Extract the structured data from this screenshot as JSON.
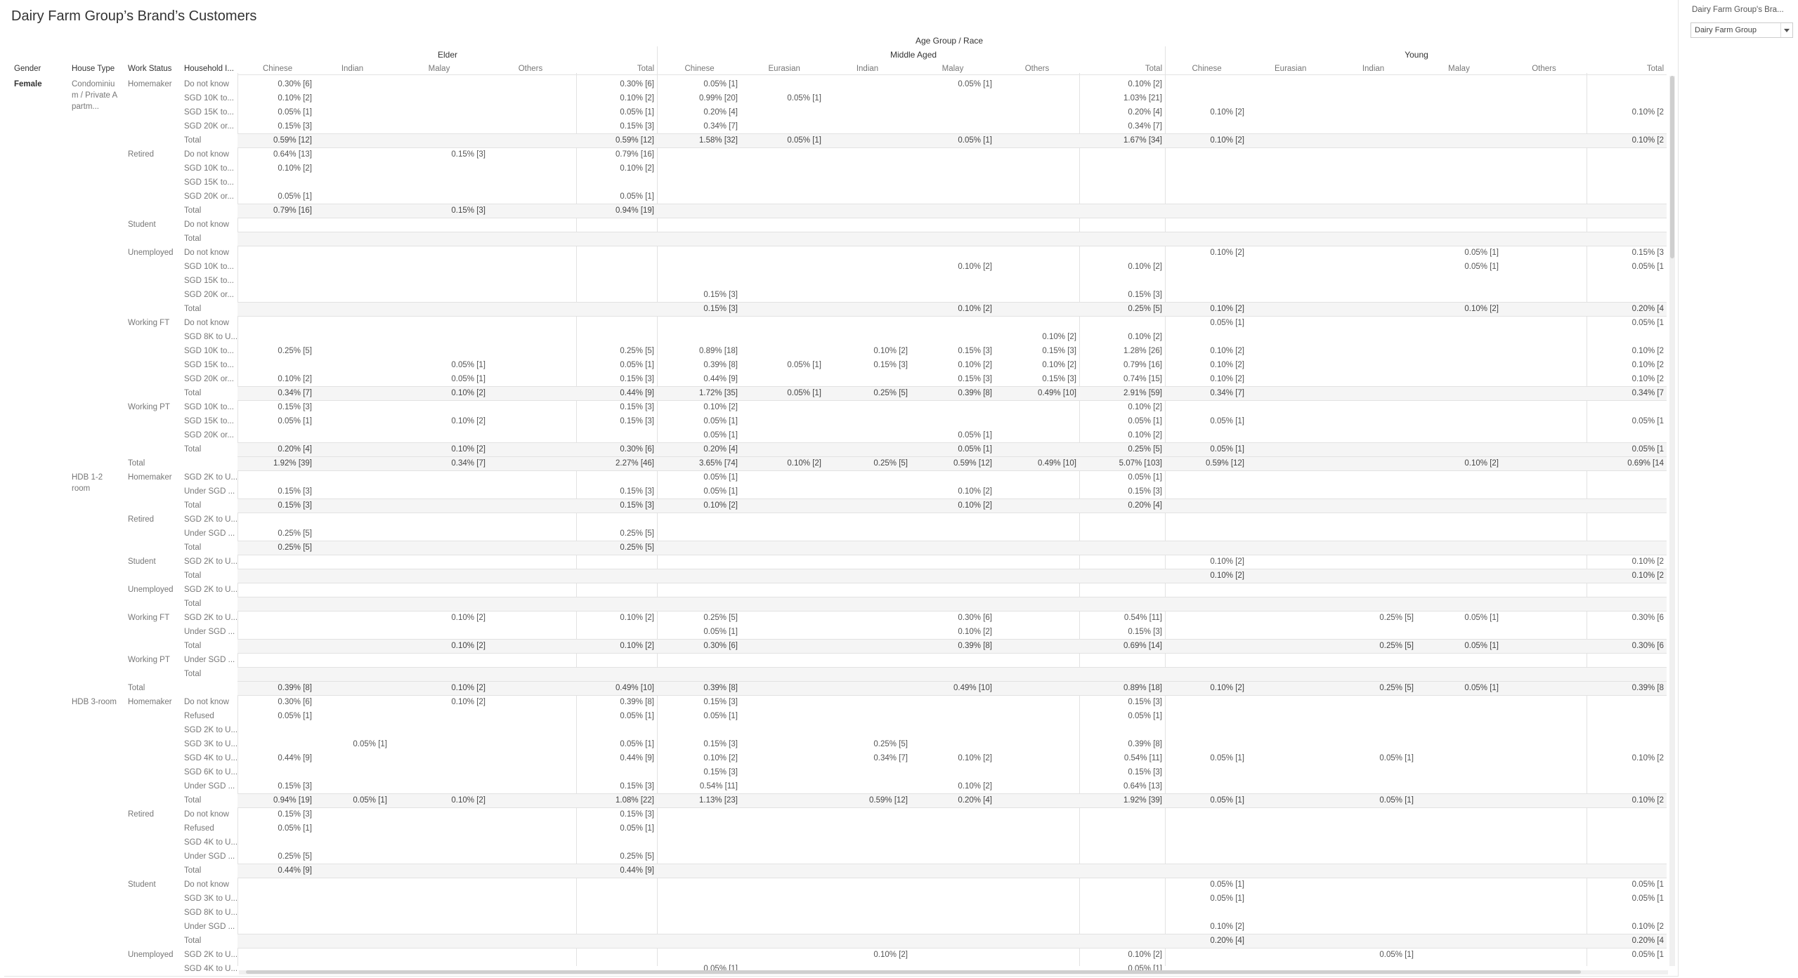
{
  "title": "Dairy Farm Group’s Brand’s Customers",
  "filter": {
    "title": "Dairy Farm Group's Bra...",
    "value": "Dairy Farm Group"
  },
  "header": {
    "top": "Age Group / Race",
    "groups": [
      "Elder",
      "Middle Aged",
      "Young"
    ],
    "row_headers": [
      "Gender",
      "House Type",
      "Work Status",
      "Household I..."
    ],
    "columns": [
      "Chinese",
      "Indian",
      "Malay",
      "Others",
      "Total",
      "Chinese",
      "Eurasian",
      "Indian",
      "Malay",
      "Others",
      "Total",
      "Chinese",
      "Eurasian",
      "Indian",
      "Malay",
      "Others",
      "Total"
    ]
  },
  "groups": [
    {
      "label": "Female",
      "row": 0
    },
    {
      "label": "Condominiu\nm / Private A\npartm...",
      "row": 0
    },
    {
      "label": "HDB 1-2\nroom",
      "row": 28
    },
    {
      "label": "HDB 3-room",
      "row": 44
    }
  ],
  "work_labels": [
    {
      "label": "Homemaker",
      "row": 0
    },
    {
      "label": "Retired",
      "row": 5
    },
    {
      "label": "Student",
      "row": 10
    },
    {
      "label": "Unemployed",
      "row": 12
    },
    {
      "label": "Working FT",
      "row": 17
    },
    {
      "label": "Working PT",
      "row": 23
    },
    {
      "label": "Total",
      "row": 27
    },
    {
      "label": "Homemaker",
      "row": 28
    },
    {
      "label": "Retired",
      "row": 31
    },
    {
      "label": "Student",
      "row": 34
    },
    {
      "label": "Unemployed",
      "row": 36
    },
    {
      "label": "Working FT",
      "row": 38
    },
    {
      "label": "Working PT",
      "row": 41
    },
    {
      "label": "Total",
      "row": 43
    },
    {
      "label": "Homemaker",
      "row": 44
    },
    {
      "label": "Retired",
      "row": 52
    },
    {
      "label": "Student",
      "row": 57
    },
    {
      "label": "Unemployed",
      "row": 62
    }
  ],
  "rows": [
    {
      "label": "Do not know",
      "cells": {
        "0": "0.30% [6]",
        "4": "0.30% [6]",
        "5": "0.05% [1]",
        "8": "0.05% [1]",
        "10": "0.10% [2]"
      }
    },
    {
      "label": "SGD 10K to...",
      "cells": {
        "0": "0.10% [2]",
        "4": "0.10% [2]",
        "5": "0.99% [20]",
        "6": "0.05% [1]",
        "10": "1.03% [21]"
      }
    },
    {
      "label": "SGD 15K to...",
      "cells": {
        "0": "0.05% [1]",
        "4": "0.05% [1]",
        "5": "0.20% [4]",
        "10": "0.20% [4]",
        "11": "0.10% [2]",
        "16": "0.10% [2"
      }
    },
    {
      "label": "SGD 20K or...",
      "cells": {
        "0": "0.15% [3]",
        "4": "0.15% [3]",
        "5": "0.34% [7]",
        "10": "0.34% [7]"
      }
    },
    {
      "label": "Total",
      "total": true,
      "cells": {
        "0": "0.59% [12]",
        "4": "0.59% [12]",
        "5": "1.58% [32]",
        "6": "0.05% [1]",
        "8": "0.05% [1]",
        "10": "1.67% [34]",
        "11": "0.10% [2]",
        "16": "0.10% [2"
      }
    },
    {
      "label": "Do not know",
      "cells": {
        "0": "0.64% [13]",
        "2": "0.15% [3]",
        "4": "0.79% [16]"
      }
    },
    {
      "label": "SGD 10K to...",
      "cells": {
        "0": "0.10% [2]",
        "4": "0.10% [2]"
      }
    },
    {
      "label": "SGD 15K to...",
      "cells": {}
    },
    {
      "label": "SGD 20K or...",
      "cells": {
        "0": "0.05% [1]",
        "4": "0.05% [1]"
      }
    },
    {
      "label": "Total",
      "total": true,
      "cells": {
        "0": "0.79% [16]",
        "2": "0.15% [3]",
        "4": "0.94% [19]"
      }
    },
    {
      "label": "Do not know",
      "cells": {}
    },
    {
      "label": "Total",
      "total": true,
      "cells": {}
    },
    {
      "label": "Do not know",
      "cells": {
        "11": "0.10% [2]",
        "14": "0.05% [1]",
        "16": "0.15% [3"
      }
    },
    {
      "label": "SGD 10K to...",
      "cells": {
        "8": "0.10% [2]",
        "10": "0.10% [2]",
        "14": "0.05% [1]",
        "16": "0.05% [1"
      }
    },
    {
      "label": "SGD 15K to...",
      "cells": {}
    },
    {
      "label": "SGD 20K or...",
      "cells": {
        "5": "0.15% [3]",
        "10": "0.15% [3]"
      }
    },
    {
      "label": "Total",
      "total": true,
      "cells": {
        "5": "0.15% [3]",
        "8": "0.10% [2]",
        "10": "0.25% [5]",
        "11": "0.10% [2]",
        "14": "0.10% [2]",
        "16": "0.20% [4"
      }
    },
    {
      "label": "Do not know",
      "cells": {
        "11": "0.05% [1]",
        "16": "0.05% [1"
      }
    },
    {
      "label": "SGD 8K to U...",
      "cells": {
        "9": "0.10% [2]",
        "10": "0.10% [2]"
      }
    },
    {
      "label": "SGD 10K to...",
      "cells": {
        "0": "0.25% [5]",
        "4": "0.25% [5]",
        "5": "0.89% [18]",
        "7": "0.10% [2]",
        "8": "0.15% [3]",
        "9": "0.15% [3]",
        "10": "1.28% [26]",
        "11": "0.10% [2]",
        "16": "0.10% [2"
      }
    },
    {
      "label": "SGD 15K to...",
      "cells": {
        "2": "0.05% [1]",
        "4": "0.05% [1]",
        "5": "0.39% [8]",
        "6": "0.05% [1]",
        "7": "0.15% [3]",
        "8": "0.10% [2]",
        "9": "0.10% [2]",
        "10": "0.79% [16]",
        "11": "0.10% [2]",
        "16": "0.10% [2"
      }
    },
    {
      "label": "SGD 20K or...",
      "cells": {
        "0": "0.10% [2]",
        "2": "0.05% [1]",
        "4": "0.15% [3]",
        "5": "0.44% [9]",
        "8": "0.15% [3]",
        "9": "0.15% [3]",
        "10": "0.74% [15]",
        "11": "0.10% [2]",
        "16": "0.10% [2"
      }
    },
    {
      "label": "Total",
      "total": true,
      "cells": {
        "0": "0.34% [7]",
        "2": "0.10% [2]",
        "4": "0.44% [9]",
        "5": "1.72% [35]",
        "6": "0.05% [1]",
        "7": "0.25% [5]",
        "8": "0.39% [8]",
        "9": "0.49% [10]",
        "10": "2.91% [59]",
        "11": "0.34% [7]",
        "16": "0.34% [7"
      }
    },
    {
      "label": "SGD 10K to...",
      "cells": {
        "0": "0.15% [3]",
        "4": "0.15% [3]",
        "5": "0.10% [2]",
        "10": "0.10% [2]"
      }
    },
    {
      "label": "SGD 15K to...",
      "cells": {
        "0": "0.05% [1]",
        "2": "0.10% [2]",
        "4": "0.15% [3]",
        "5": "0.05% [1]",
        "10": "0.05% [1]",
        "11": "0.05% [1]",
        "16": "0.05% [1"
      }
    },
    {
      "label": "SGD 20K or...",
      "cells": {
        "5": "0.05% [1]",
        "8": "0.05% [1]",
        "10": "0.10% [2]"
      }
    },
    {
      "label": "Total",
      "total": true,
      "cells": {
        "0": "0.20% [4]",
        "2": "0.10% [2]",
        "4": "0.30% [6]",
        "5": "0.20% [4]",
        "8": "0.05% [1]",
        "10": "0.25% [5]",
        "11": "0.05% [1]",
        "16": "0.05% [1"
      }
    },
    {
      "label": "",
      "grand": true,
      "cells": {
        "0": "1.92% [39]",
        "2": "0.34% [7]",
        "4": "2.27% [46]",
        "5": "3.65% [74]",
        "6": "0.10% [2]",
        "7": "0.25% [5]",
        "8": "0.59% [12]",
        "9": "0.49% [10]",
        "10": "5.07% [103]",
        "11": "0.59% [12]",
        "14": "0.10% [2]",
        "16": "0.69% [14"
      }
    },
    {
      "label": "SGD 2K to U...",
      "cells": {
        "5": "0.05% [1]",
        "10": "0.05% [1]"
      }
    },
    {
      "label": "Under SGD ...",
      "cells": {
        "0": "0.15% [3]",
        "4": "0.15% [3]",
        "5": "0.05% [1]",
        "8": "0.10% [2]",
        "10": "0.15% [3]"
      }
    },
    {
      "label": "Total",
      "total": true,
      "cells": {
        "0": "0.15% [3]",
        "4": "0.15% [3]",
        "5": "0.10% [2]",
        "8": "0.10% [2]",
        "10": "0.20% [4]"
      }
    },
    {
      "label": "SGD 2K to U...",
      "cells": {}
    },
    {
      "label": "Under SGD ...",
      "cells": {
        "0": "0.25% [5]",
        "4": "0.25% [5]"
      }
    },
    {
      "label": "Total",
      "total": true,
      "cells": {
        "0": "0.25% [5]",
        "4": "0.25% [5]"
      }
    },
    {
      "label": "SGD 2K to U...",
      "cells": {
        "11": "0.10% [2]",
        "16": "0.10% [2"
      }
    },
    {
      "label": "Total",
      "total": true,
      "cells": {
        "11": "0.10% [2]",
        "16": "0.10% [2"
      }
    },
    {
      "label": "SGD 2K to U...",
      "cells": {}
    },
    {
      "label": "Total",
      "total": true,
      "cells": {}
    },
    {
      "label": "SGD 2K to U...",
      "cells": {
        "2": "0.10% [2]",
        "4": "0.10% [2]",
        "5": "0.25% [5]",
        "8": "0.30% [6]",
        "10": "0.54% [11]",
        "13": "0.25% [5]",
        "14": "0.05% [1]",
        "16": "0.30% [6"
      }
    },
    {
      "label": "Under SGD ...",
      "cells": {
        "5": "0.05% [1]",
        "8": "0.10% [2]",
        "10": "0.15% [3]"
      }
    },
    {
      "label": "Total",
      "total": true,
      "cells": {
        "2": "0.10% [2]",
        "4": "0.10% [2]",
        "5": "0.30% [6]",
        "8": "0.39% [8]",
        "10": "0.69% [14]",
        "13": "0.25% [5]",
        "14": "0.05% [1]",
        "16": "0.30% [6"
      }
    },
    {
      "label": "Under SGD ...",
      "cells": {}
    },
    {
      "label": "Total",
      "total": true,
      "cells": {}
    },
    {
      "label": "",
      "grand": true,
      "cells": {
        "0": "0.39% [8]",
        "2": "0.10% [2]",
        "4": "0.49% [10]",
        "5": "0.39% [8]",
        "8": "0.49% [10]",
        "10": "0.89% [18]",
        "11": "0.10% [2]",
        "13": "0.25% [5]",
        "14": "0.05% [1]",
        "16": "0.39% [8"
      }
    },
    {
      "label": "Do not know",
      "cells": {
        "0": "0.30% [6]",
        "2": "0.10% [2]",
        "4": "0.39% [8]",
        "5": "0.15% [3]",
        "10": "0.15% [3]"
      }
    },
    {
      "label": "Refused",
      "cells": {
        "0": "0.05% [1]",
        "4": "0.05% [1]",
        "5": "0.05% [1]",
        "10": "0.05% [1]"
      }
    },
    {
      "label": "SGD 2K to U...",
      "cells": {}
    },
    {
      "label": "SGD 3K to U...",
      "cells": {
        "1": "0.05% [1]",
        "4": "0.05% [1]",
        "5": "0.15% [3]",
        "7": "0.25% [5]",
        "10": "0.39% [8]"
      }
    },
    {
      "label": "SGD 4K to U...",
      "cells": {
        "0": "0.44% [9]",
        "4": "0.44% [9]",
        "5": "0.10% [2]",
        "7": "0.34% [7]",
        "8": "0.10% [2]",
        "10": "0.54% [11]",
        "11": "0.05% [1]",
        "13": "0.05% [1]",
        "16": "0.10% [2"
      }
    },
    {
      "label": "SGD 6K to U...",
      "cells": {
        "5": "0.15% [3]",
        "10": "0.15% [3]"
      }
    },
    {
      "label": "Under SGD ...",
      "cells": {
        "0": "0.15% [3]",
        "4": "0.15% [3]",
        "5": "0.54% [11]",
        "8": "0.10% [2]",
        "10": "0.64% [13]"
      }
    },
    {
      "label": "Total",
      "total": true,
      "cells": {
        "0": "0.94% [19]",
        "1": "0.05% [1]",
        "2": "0.10% [2]",
        "4": "1.08% [22]",
        "5": "1.13% [23]",
        "7": "0.59% [12]",
        "8": "0.20% [4]",
        "10": "1.92% [39]",
        "11": "0.05% [1]",
        "13": "0.05% [1]",
        "16": "0.10% [2"
      }
    },
    {
      "label": "Do not know",
      "cells": {
        "0": "0.15% [3]",
        "4": "0.15% [3]"
      }
    },
    {
      "label": "Refused",
      "cells": {
        "0": "0.05% [1]",
        "4": "0.05% [1]"
      }
    },
    {
      "label": "SGD 4K to U...",
      "cells": {}
    },
    {
      "label": "Under SGD ...",
      "cells": {
        "0": "0.25% [5]",
        "4": "0.25% [5]"
      }
    },
    {
      "label": "Total",
      "total": true,
      "cells": {
        "0": "0.44% [9]",
        "4": "0.44% [9]"
      }
    },
    {
      "label": "Do not know",
      "cells": {
        "11": "0.05% [1]",
        "16": "0.05% [1"
      }
    },
    {
      "label": "SGD 3K to U...",
      "cells": {
        "11": "0.05% [1]",
        "16": "0.05% [1"
      }
    },
    {
      "label": "SGD 8K to U...",
      "cells": {}
    },
    {
      "label": "Under SGD ...",
      "cells": {
        "11": "0.10% [2]",
        "16": "0.10% [2"
      }
    },
    {
      "label": "Total",
      "total": true,
      "cells": {
        "11": "0.20% [4]",
        "16": "0.20% [4"
      }
    },
    {
      "label": "SGD 2K to U...",
      "cells": {
        "7": "0.10% [2]",
        "10": "0.10% [2]",
        "13": "0.05% [1]",
        "16": "0.05% [1"
      }
    },
    {
      "label": "SGD 4K to U...",
      "cells": {
        "5": "0.05% [1]",
        "10": "0.05% [1]"
      }
    }
  ]
}
